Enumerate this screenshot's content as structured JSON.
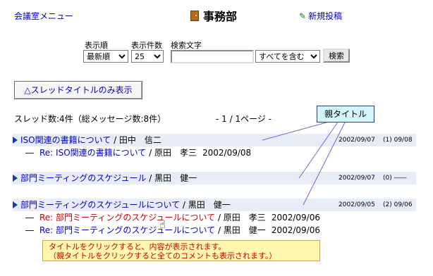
{
  "header": {
    "menu_link": "会議室メニュー",
    "title": "事務部",
    "new_post": "新規投稿"
  },
  "controls": {
    "order_label": "表示順",
    "order_value": "最新順",
    "count_label": "表示件数",
    "count_value": "25",
    "search_label": "検索文字",
    "search_value": "",
    "scope_value": "すべてを含む",
    "search_button": "検索"
  },
  "toggle_button": "△スレッドタイトルのみ表示",
  "summary": {
    "count": "スレッド数:4件（総メッセージ数:8件）",
    "pager": "- 1 / 1ページ -"
  },
  "tooltip": "親タイトル",
  "threads": [
    {
      "title": "ISO関連の書籍について",
      "author": "田中　信二",
      "date": "2002/09/07",
      "replies": "(1) 09/08",
      "children": [
        {
          "title": "Re: ISO関連の書籍について",
          "author": "原田　孝三",
          "date": "2002/09/08",
          "visited": false
        }
      ]
    },
    {
      "title": "部門ミーティングのスケジュール",
      "author": "黒田　健一",
      "date": "2002/09/07",
      "replies": "(0) ――",
      "children": []
    },
    {
      "title": "部門ミーティングのスケジュールについて",
      "author": "黒田　健一",
      "date": "2002/09/05",
      "replies": "(2) 09/06",
      "children": [
        {
          "title": "Re: 部門ミーティングのスケジュールについて",
          "author": "原田　孝三",
          "date": "2002/09/06",
          "visited": true
        },
        {
          "title": "Re: 部門ミーティングのスケジュールについて",
          "author": "黒田　健一",
          "date": "2002/09/06",
          "visited": false
        }
      ]
    }
  ],
  "note": {
    "line1": "タイトルをクリックすると、内容が表示されます。",
    "line2": "（親タイトルをクリックすると全てのコメントも表示されます。）"
  }
}
